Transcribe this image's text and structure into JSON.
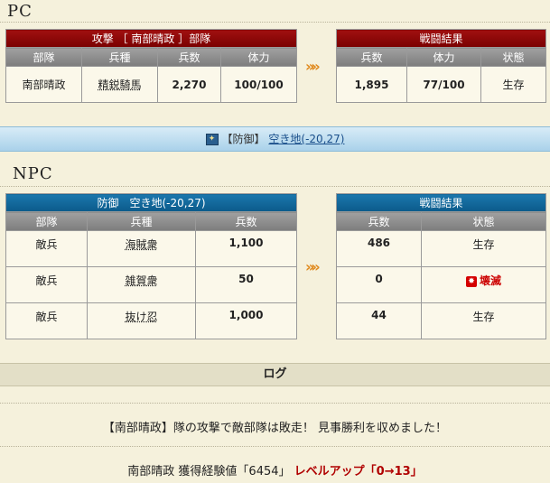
{
  "pc": {
    "section_title": "PC",
    "attack_header": "攻撃 ［ 南部晴政 ］部隊",
    "columns": [
      "部隊",
      "兵種",
      "兵数",
      "体力"
    ],
    "row": {
      "unit": "南部晴政",
      "type": "精鋭騎馬",
      "count": "2,270",
      "hp": "100/100"
    },
    "result_header": "戦闘結果",
    "result_columns": [
      "兵数",
      "体力",
      "状態"
    ],
    "result_row": {
      "count": "1,895",
      "hp": "77/100",
      "status": "生存"
    }
  },
  "arrow": "»»",
  "defense_bar": {
    "label": "【防御】",
    "location": "空き地(-20,27)"
  },
  "npc": {
    "section_title": "NPC",
    "defense_header": "防御　空き地(-20,27)",
    "columns": [
      "部隊",
      "兵種",
      "兵数"
    ],
    "rows": [
      {
        "unit": "敵兵",
        "type": "海賊衆",
        "count": "1,100"
      },
      {
        "unit": "敵兵",
        "type": "雑賀衆",
        "count": "50"
      },
      {
        "unit": "敵兵",
        "type": "抜け忍",
        "count": "1,000"
      }
    ],
    "result_header": "戦闘結果",
    "result_columns": [
      "兵数",
      "状態"
    ],
    "result_rows": [
      {
        "count": "486",
        "status": "生存"
      },
      {
        "count": "0",
        "status": "壊滅"
      },
      {
        "count": "44",
        "status": "生存"
      }
    ]
  },
  "log": {
    "header": "ログ",
    "victory": "【南部晴政】隊の攻撃で敵部隊は敗走！ 見事勝利を収めました！",
    "exp_prefix": "南部晴政 獲得経験値「6454」",
    "level_up": "レベルアップ「0→13」"
  },
  "colors": {
    "pc_header": "#8b0000",
    "npc_header": "#0b5a8a",
    "destroyed": "#cc0000"
  }
}
